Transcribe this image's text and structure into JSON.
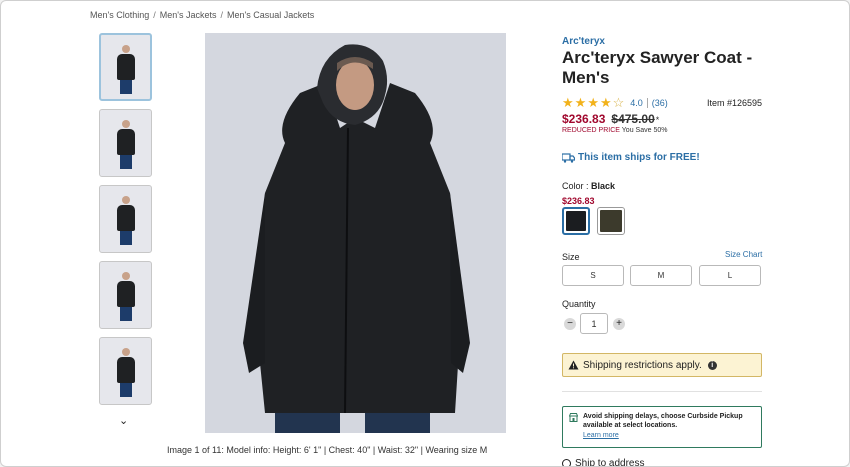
{
  "breadcrumb": [
    "Men's Clothing",
    "Men's Jackets",
    "Men's Casual Jackets"
  ],
  "breadcrumb_separator": "/",
  "gallery": {
    "thumbnail_count_visible": 5,
    "caption": "Image 1 of 11: Model info: Height: 6' 1\" | Chest: 40\" | Waist: 32\" | Wearing size M",
    "next_arrow": "⌄"
  },
  "product": {
    "brand": "Arc'teryx",
    "title": "Arc'teryx Sawyer Coat - Men's",
    "rating_value": "4.0",
    "rating_count": "(36)",
    "stars_filled": 4,
    "item_number": "Item #126595",
    "price_sale": "$236.83",
    "price_original": "$475.00",
    "price_footnote": "*",
    "reduced_label": "REDUCED PRICE",
    "you_save": "You Save 50%",
    "shipping_text": "This item ships for FREE!"
  },
  "color": {
    "label": "Color :",
    "selected": "Black",
    "price": "$236.83",
    "swatches": [
      {
        "name": "Black",
        "hex": "#1b1d20"
      },
      {
        "name": "Olive",
        "hex": "#3c3a2c"
      }
    ]
  },
  "size": {
    "label": "Size",
    "chart_link": "Size Chart",
    "options": [
      "S",
      "M",
      "L"
    ]
  },
  "quantity": {
    "label": "Quantity",
    "value": "1",
    "minus": "−",
    "plus": "+"
  },
  "notices": {
    "restriction": "Shipping restrictions apply.",
    "curbside_message": "Avoid shipping delays, choose Curbside Pickup available at select locations.",
    "learn_more": "Learn more",
    "ship_to": "Ship to address"
  },
  "colors": {
    "link_blue": "#2b6ea5",
    "sale_red": "#a1082e",
    "star_gold": "#f2b21b",
    "warning_bg": "#fcf3d3",
    "curbside_green": "#2f7a5e"
  }
}
